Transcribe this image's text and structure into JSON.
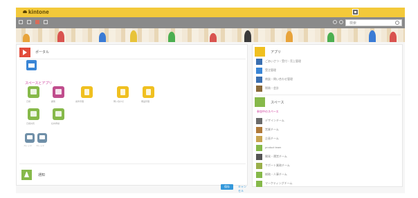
{
  "header": {
    "logo": "kintone",
    "brand_color": "#f3c93a"
  },
  "search": {
    "placeholder": "検索"
  },
  "portal": {
    "title": "ポータル",
    "space_label": "スペースとアプリ"
  },
  "apps": [
    {
      "label": "日報",
      "color": "green"
    },
    {
      "label": "顧客",
      "color": "pink"
    },
    {
      "label": "案件管理",
      "color": "yellow"
    },
    {
      "label": "問い合わせ",
      "color": "yellow"
    },
    {
      "label": "備品管理",
      "color": "yellow"
    },
    {
      "label": "日報共有",
      "color": "green"
    },
    {
      "label": "社内申請",
      "color": "green"
    },
    {
      "label": "スレッド",
      "color": "grey"
    },
    {
      "label": "スレッド",
      "color": "grey"
    }
  ],
  "notices": {
    "label": "通知",
    "save_label": "保存",
    "cancel_label": "キャンセル"
  },
  "right": {
    "app_section": {
      "title": "アプリ",
      "items": [
        {
          "label": "ごあいさつ・受付・売上管理",
          "color": "#3a6fb0"
        },
        {
          "label": "受注管理",
          "color": "#3a86d6"
        },
        {
          "label": "商談・問い合わせ管理",
          "color": "#3a6fb0"
        },
        {
          "label": "税務・会計",
          "color": "#8a6a3a"
        }
      ]
    },
    "space_section": {
      "title": "スペース",
      "subtitle": "参加中のスペース",
      "items": [
        {
          "label": "デザインチーム",
          "color": "#6a6a6a"
        },
        {
          "label": "営業チーム",
          "color": "#b07a3a"
        },
        {
          "label": "企画チーム",
          "color": "#c8a450"
        },
        {
          "label": "product team",
          "color": "#86b94a"
        },
        {
          "label": "開発・運営チーム",
          "color": "#555555"
        },
        {
          "label": "サポート業務チーム",
          "color": "#9ab04a"
        },
        {
          "label": "総務・人事チーム",
          "color": "#86b94a"
        },
        {
          "label": "マーケティングチーム",
          "color": "#86b94a"
        }
      ]
    }
  }
}
